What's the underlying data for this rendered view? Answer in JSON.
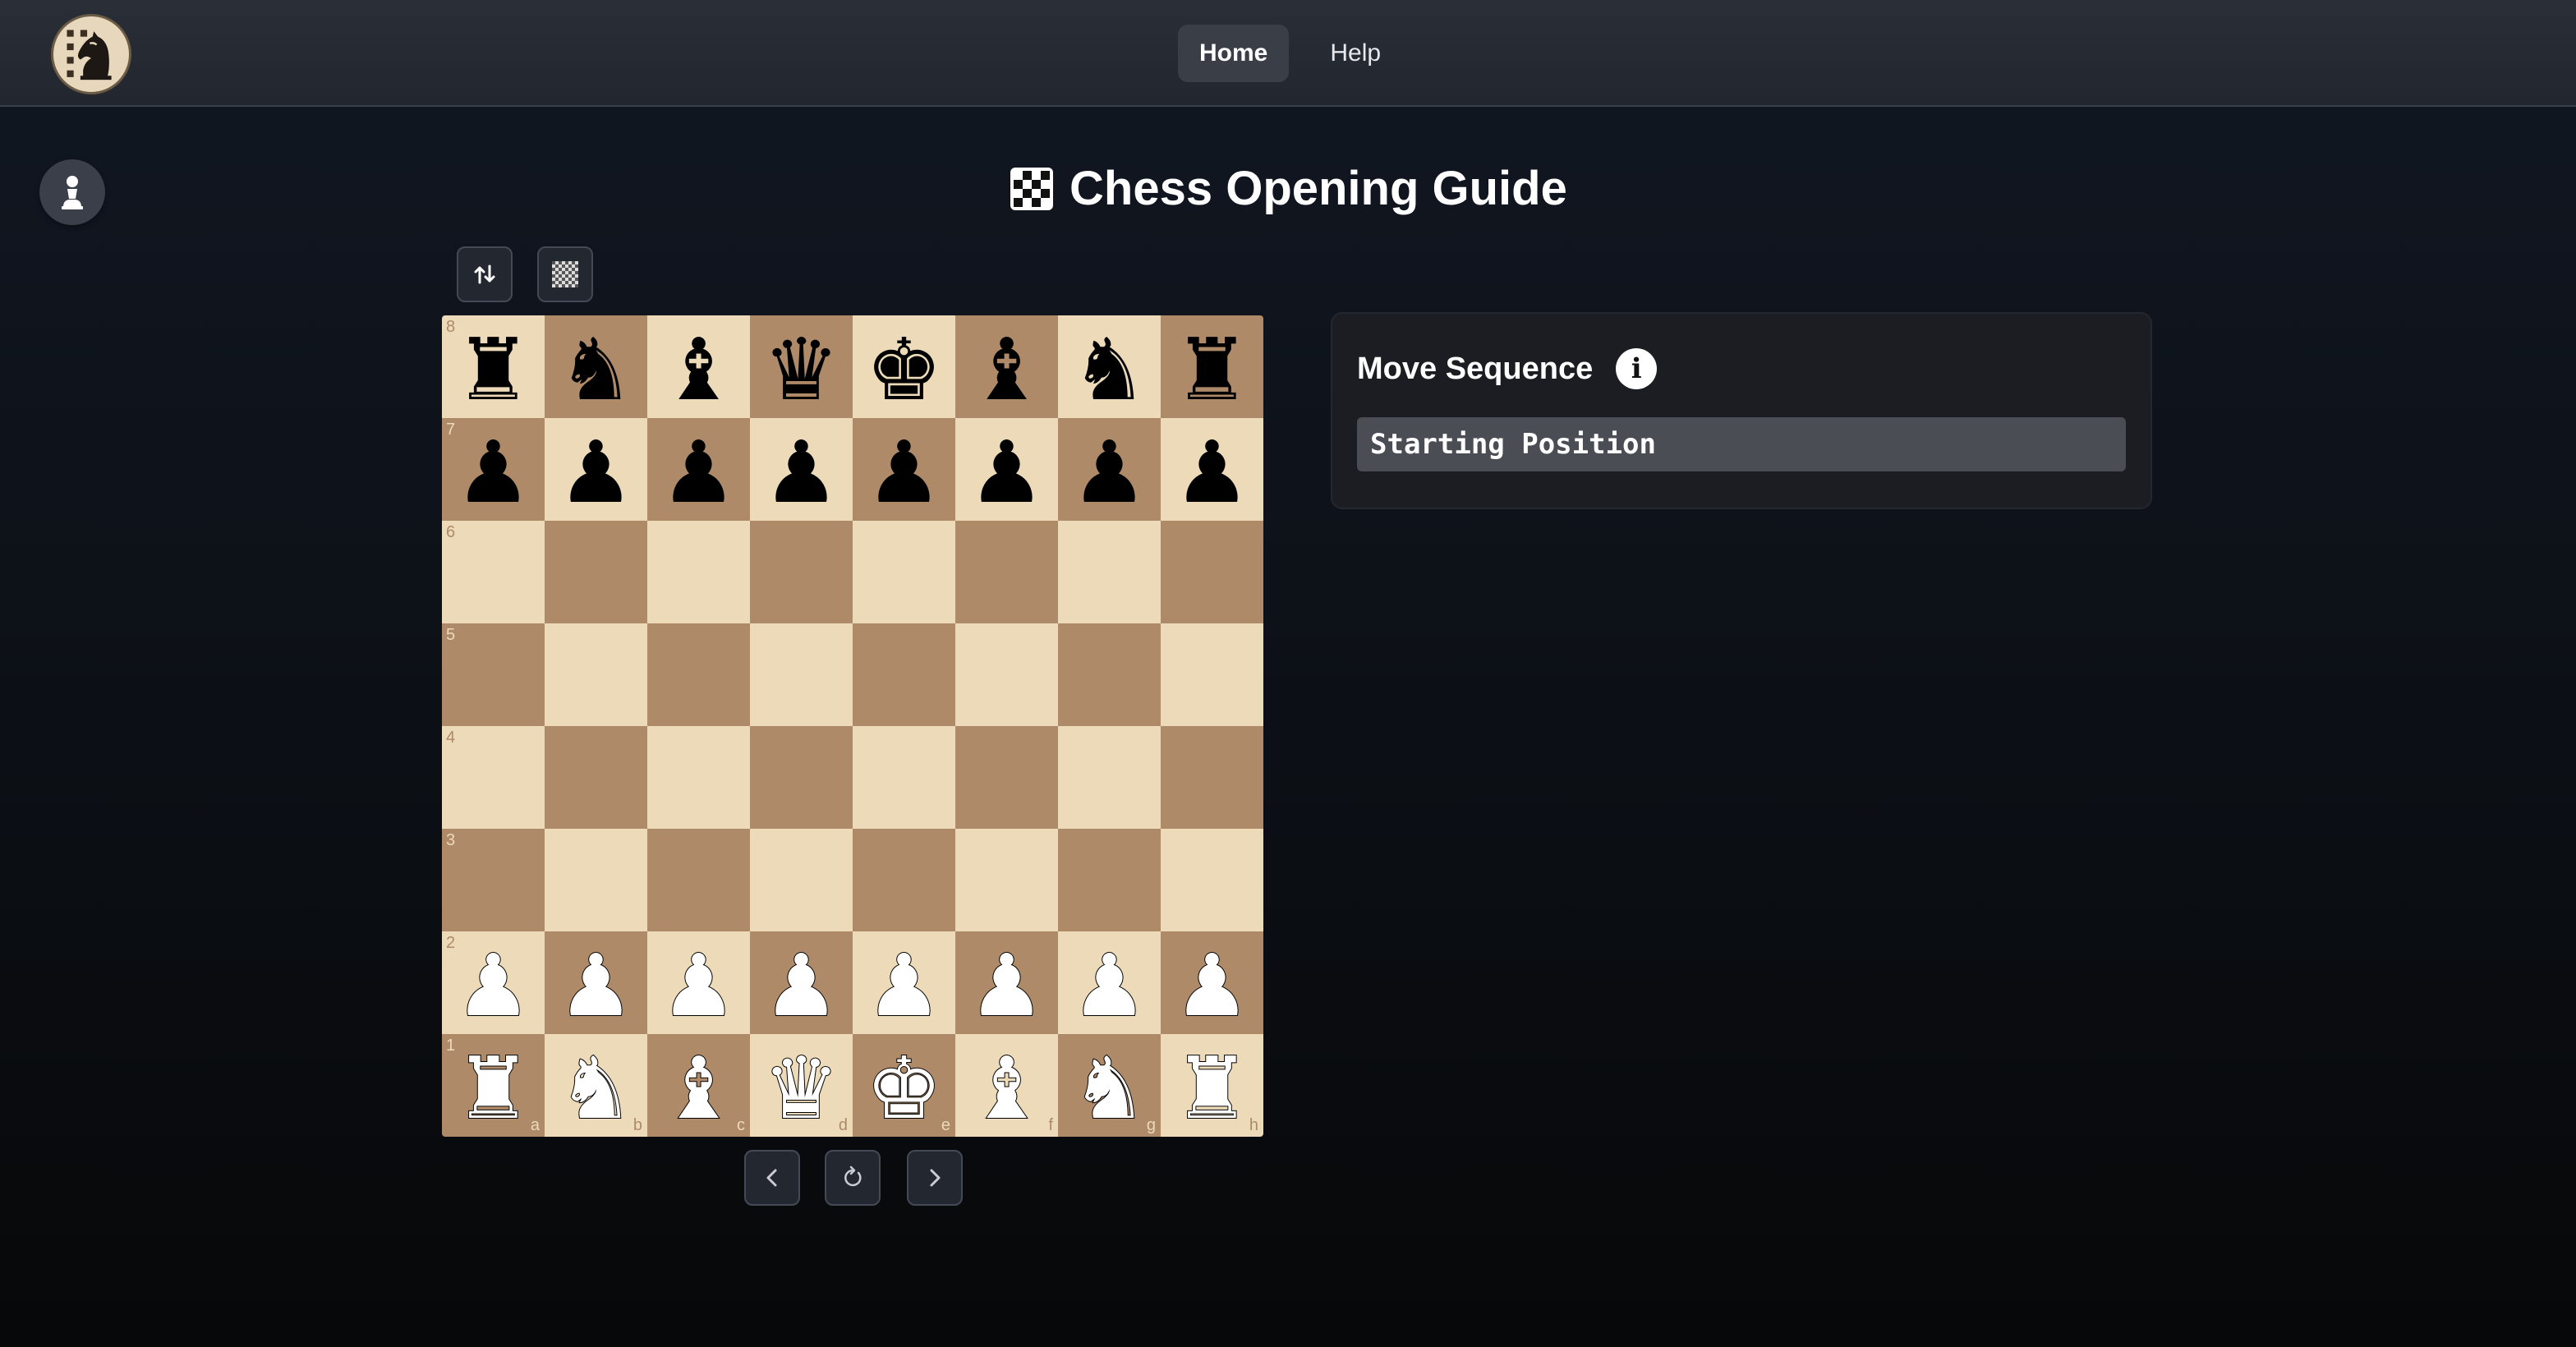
{
  "nav": {
    "links": [
      {
        "label": "Home",
        "active": true
      },
      {
        "label": "Help",
        "active": false
      }
    ]
  },
  "page": {
    "title": "Chess Opening Guide"
  },
  "board": {
    "files": [
      "a",
      "b",
      "c",
      "d",
      "e",
      "f",
      "g",
      "h"
    ],
    "ranks": [
      "8",
      "7",
      "6",
      "5",
      "4",
      "3",
      "2",
      "1"
    ],
    "position": [
      [
        "bR",
        "bN",
        "bB",
        "bQ",
        "bK",
        "bB",
        "bN",
        "bR"
      ],
      [
        "bP",
        "bP",
        "bP",
        "bP",
        "bP",
        "bP",
        "bP",
        "bP"
      ],
      [
        "",
        "",
        "",
        "",
        "",
        "",
        "",
        ""
      ],
      [
        "",
        "",
        "",
        "",
        "",
        "",
        "",
        ""
      ],
      [
        "",
        "",
        "",
        "",
        "",
        "",
        "",
        ""
      ],
      [
        "",
        "",
        "",
        "",
        "",
        "",
        "",
        ""
      ],
      [
        "wP",
        "wP",
        "wP",
        "wP",
        "wP",
        "wP",
        "wP",
        "wP"
      ],
      [
        "wR",
        "wN",
        "wB",
        "wQ",
        "wK",
        "wB",
        "wN",
        "wR"
      ]
    ],
    "light_color": "#ecdab9",
    "dark_color": "#ae8a68"
  },
  "toolbar": {
    "flip_icon": "swap-vertical-icon",
    "theme_icon": "checkerboard-icon"
  },
  "controls": {
    "prev_icon": "chevron-left-icon",
    "reset_icon": "refresh-icon",
    "next_icon": "chevron-right-icon"
  },
  "move_panel": {
    "title": "Move Sequence",
    "current": "Starting Position"
  }
}
